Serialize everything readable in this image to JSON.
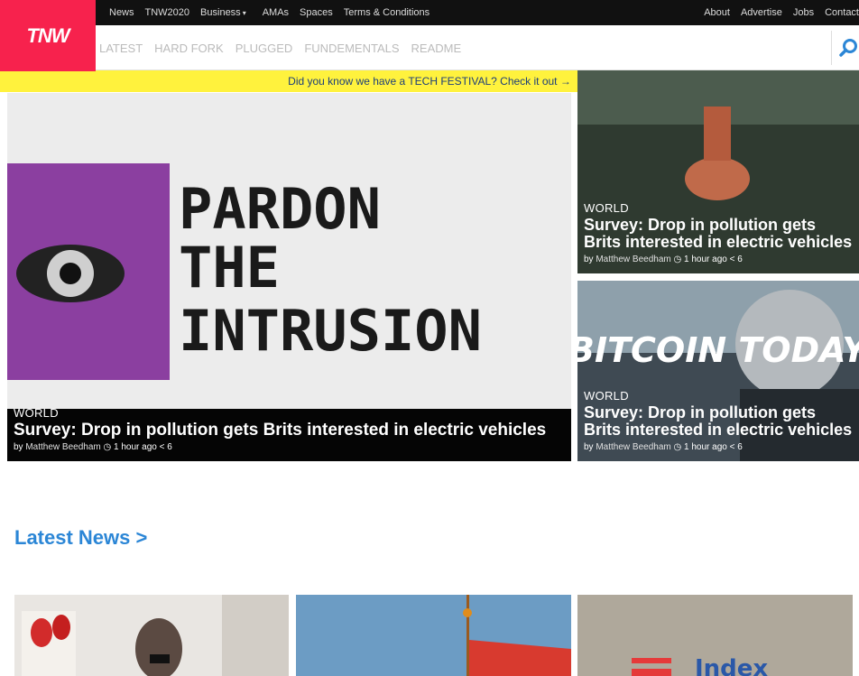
{
  "topbar": {
    "links": [
      "News",
      "TNW2020",
      "Business",
      "AMAs",
      "Spaces",
      "Terms & Conditions"
    ],
    "right_links": [
      "About",
      "Advertise",
      "Jobs",
      "Contact"
    ]
  },
  "logo": {
    "text": "TNW"
  },
  "nav": {
    "items": [
      "LATEST",
      "HARD FORK",
      "PLUGGED",
      "FUNDEMENTALS",
      "README"
    ]
  },
  "promo": {
    "text": "Did you know we have a TECH FESTIVAL? Check it out →"
  },
  "hero": {
    "category": "WORLD",
    "title": "Survey: Drop in pollution gets Brits interested in electric vehicles",
    "author_prefix": "by",
    "author": "Matthew Beedham",
    "time": "1 hour ago",
    "shares": "6",
    "image_text": [
      "PARDON",
      "THE",
      "INTRUSION"
    ]
  },
  "side1": {
    "category": "WORLD",
    "title": "Survey: Drop in pollution gets Brits interested in electric vehicles",
    "author_prefix": "by",
    "author": "Matthew Beedham",
    "time": "1 hour ago",
    "shares": "6"
  },
  "side2": {
    "category": "WORLD",
    "title": "Survey: Drop in pollution gets Brits interested in electric vehicles",
    "author_prefix": "by",
    "author": "Matthew Beedham",
    "time": "1 hour ago",
    "shares": "6",
    "image_text": "BITCOIN TODAY"
  },
  "latest": {
    "heading": "Latest News >"
  },
  "thumb3": {
    "image_text": "Index"
  },
  "colors": {
    "brand": "#f7224d",
    "promo": "#fff23d",
    "link": "#2b86d6"
  }
}
